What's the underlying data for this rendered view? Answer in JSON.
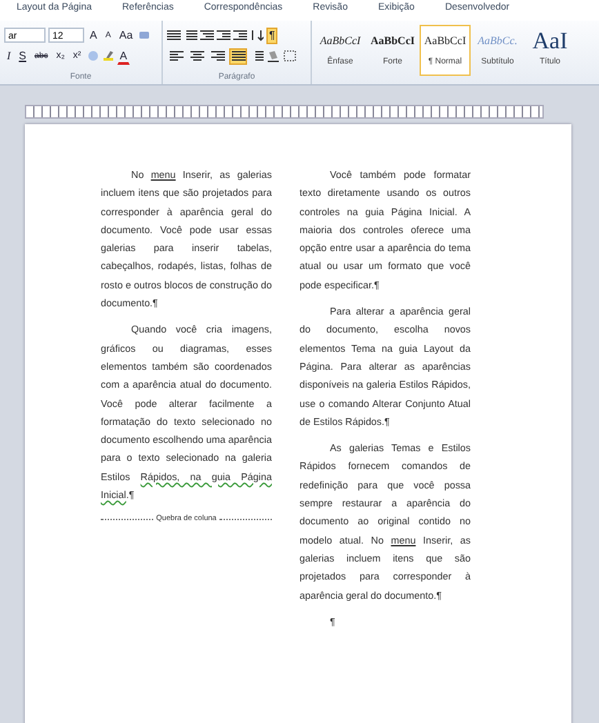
{
  "tabs": [
    {
      "label": "Layout da Página",
      "selected": false
    },
    {
      "label": "Referências",
      "selected": false
    },
    {
      "label": "Correspondências",
      "selected": false
    },
    {
      "label": "Revisão",
      "selected": false
    },
    {
      "label": "Exibição",
      "selected": false
    },
    {
      "label": "Desenvolvedor",
      "selected": false
    }
  ],
  "font_group": {
    "font_name": "ar",
    "font_size": "12",
    "grow": "A",
    "shrink": "A",
    "change_case": "Aa",
    "italic": "I",
    "underline": "S",
    "strikethrough": "abc",
    "subscript": "x₂",
    "superscript": "x²",
    "font_color": "A",
    "label": "Fonte"
  },
  "paragraph_group": {
    "show_marks": {
      "label": "¶",
      "selected": true
    },
    "alignment": [
      {
        "kind": "left",
        "selected": false
      },
      {
        "kind": "center",
        "selected": false
      },
      {
        "kind": "right",
        "selected": false
      },
      {
        "kind": "justify",
        "selected": true
      }
    ],
    "label": "Parágrafo"
  },
  "styles": [
    {
      "preview": "AaBbCcI",
      "label": "Ênfase",
      "kind": "emphasis",
      "selected": false
    },
    {
      "preview": "AaBbCcI",
      "label": "Forte",
      "kind": "strong",
      "selected": false
    },
    {
      "preview": "AaBbCcI",
      "label": "¶ Normal",
      "kind": "normal",
      "selected": true
    },
    {
      "preview": "AaBbCc.",
      "label": "Subtítulo",
      "kind": "subtitle",
      "selected": false
    },
    {
      "preview": "AaI",
      "label": "Título",
      "kind": "title",
      "selected": false
    }
  ],
  "columns": [
    {
      "paragraphs": [
        {
          "segments": [
            {
              "text": "No ",
              "kind": "plain"
            },
            {
              "text": "menu",
              "kind": "underlined"
            },
            {
              "text": " Inserir, as galerias incluem itens que são projetados para corresponder à aparência geral do documento. Você pode usar essas galerias para inserir tabelas, cabeçalhos, rodapés, listas, folhas de rosto e outros blocos de construção do documento.¶",
              "kind": "plain"
            }
          ]
        },
        {
          "segments": [
            {
              "text": "Quando você cria imagens, gráficos ou diagramas, esses elementos também são coordenados com a aparência atual do documento. Você pode alterar facilmente a formatação do texto selecionado no documento escolhendo uma aparência para o texto selecionado na galeria Estilos ",
              "kind": "plain"
            },
            {
              "text": "Rápidos, na guia Página Inicial",
              "kind": "grammar"
            },
            {
              "text": ".¶",
              "kind": "plain"
            }
          ]
        }
      ],
      "column_break": "Quebra de coluna"
    },
    {
      "paragraphs": [
        {
          "segments": [
            {
              "text": "Você também pode formatar texto diretamente usando os outros controles na guia Página Inicial. A maioria dos controles oferece uma opção entre usar a aparência do tema atual ou usar um formato que você pode especificar.¶",
              "kind": "plain"
            }
          ]
        },
        {
          "segments": [
            {
              "text": "Para alterar a aparência geral do documento, escolha novos elementos Tema na guia Layout da Página. Para alterar as aparências disponíveis na galeria Estilos Rápidos, use o comando Alterar Conjunto Atual de Estilos Rápidos.¶",
              "kind": "plain"
            }
          ]
        },
        {
          "segments": [
            {
              "text": "As galerias Temas e Estilos Rápidos fornecem comandos de redefinição para que você possa sempre restaurar a aparência do documento ao original contido no modelo atual. No ",
              "kind": "plain"
            },
            {
              "text": "menu",
              "kind": "underlined"
            },
            {
              "text": " Inserir, as galerias incluem itens que são projetados para corresponder à aparência geral do documento.¶",
              "kind": "plain"
            }
          ]
        },
        {
          "segments": [
            {
              "text": "¶",
              "kind": "plain"
            }
          ]
        }
      ]
    }
  ]
}
